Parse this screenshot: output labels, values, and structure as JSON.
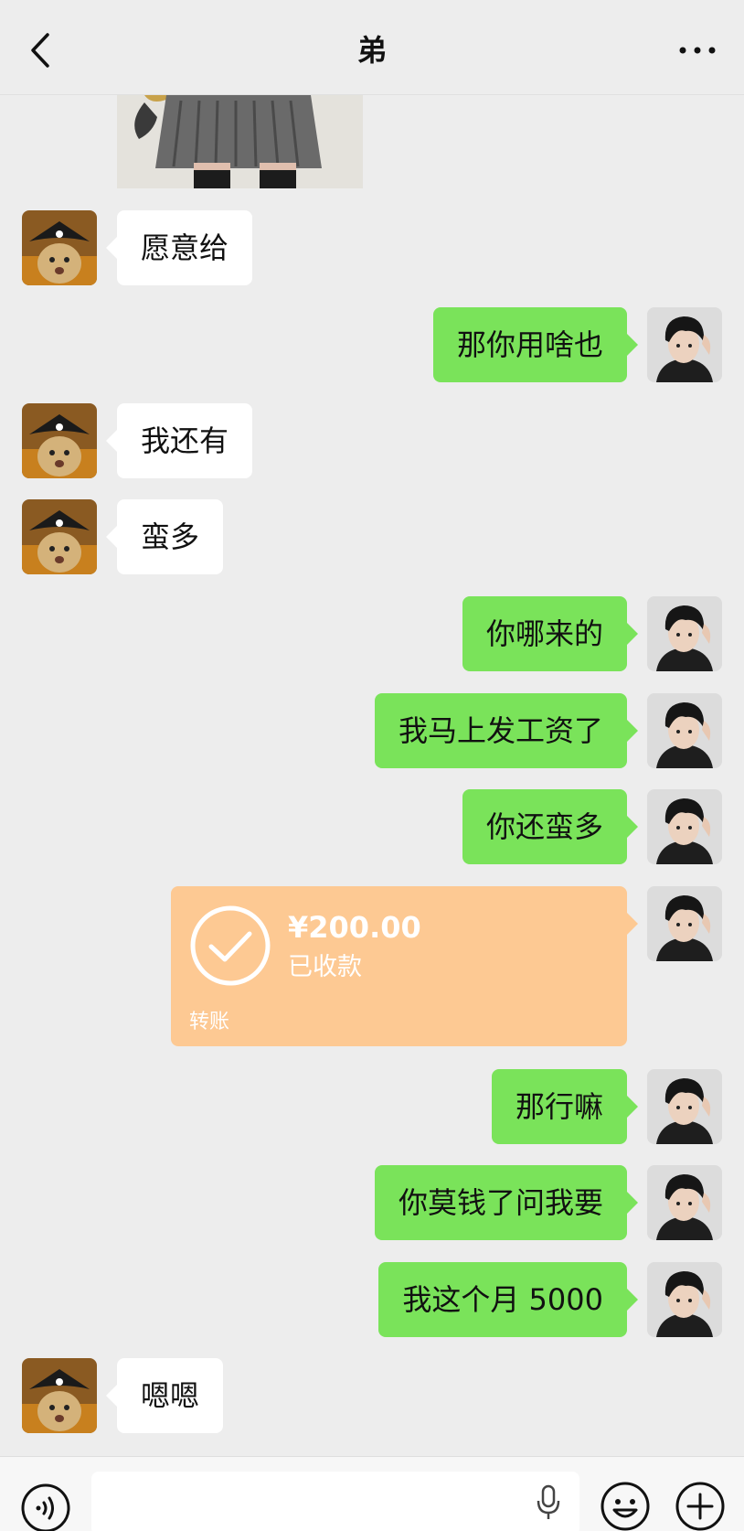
{
  "header": {
    "title": "弟"
  },
  "messages": [
    {
      "side": "left",
      "text": "愿意给"
    },
    {
      "side": "right",
      "text": "那你用啥也"
    },
    {
      "side": "left",
      "text": "我还有"
    },
    {
      "side": "left",
      "text": "蛮多"
    },
    {
      "side": "right",
      "text": "你哪来的"
    },
    {
      "side": "right",
      "text": "我马上发工资了"
    },
    {
      "side": "right",
      "text": "你还蛮多"
    },
    {
      "side": "right",
      "text": "那行嘛"
    },
    {
      "side": "right",
      "text": "你莫钱了问我要"
    },
    {
      "side": "right",
      "text": "我这个月 5000"
    },
    {
      "side": "left",
      "text": "嗯嗯"
    }
  ],
  "transfer": {
    "amount": "¥200.00",
    "status": "已收款",
    "label": "转账"
  },
  "colors": {
    "background": "#ededed",
    "sent_bubble": "#7ae35a",
    "received_bubble": "#ffffff",
    "transfer": "#fdc993"
  },
  "icons": [
    "back-arrow-icon",
    "more-dots-icon",
    "voice-icon",
    "mic-icon",
    "emoji-icon",
    "plus-icon",
    "check-circle-icon"
  ]
}
